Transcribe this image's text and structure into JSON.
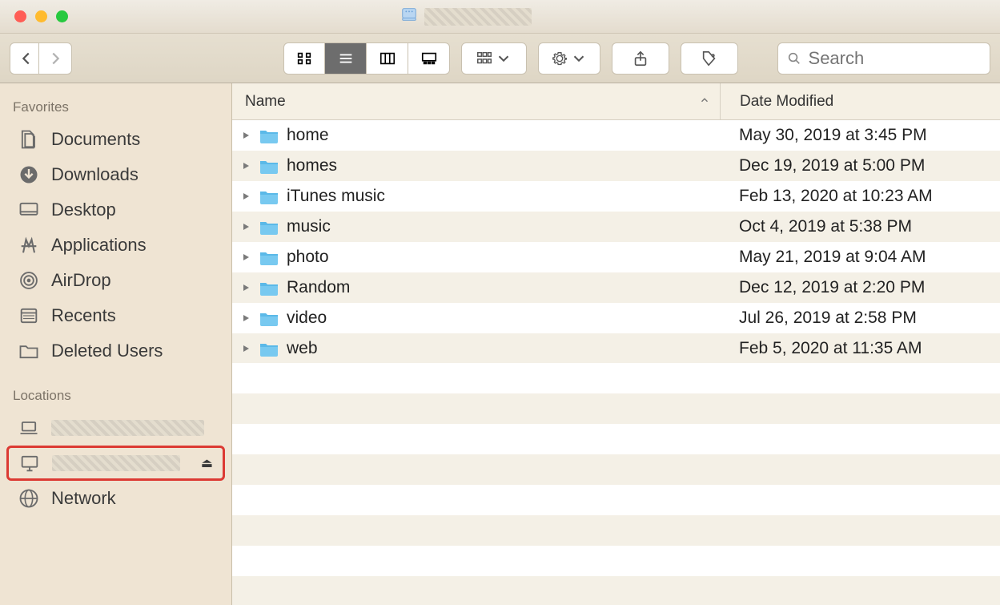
{
  "window": {
    "title_obscured": true
  },
  "sidebar": {
    "favorites_label": "Favorites",
    "locations_label": "Locations",
    "favorites": [
      {
        "label": "Documents",
        "icon": "documents"
      },
      {
        "label": "Downloads",
        "icon": "downloads"
      },
      {
        "label": "Desktop",
        "icon": "desktop"
      },
      {
        "label": "Applications",
        "icon": "applications"
      },
      {
        "label": "AirDrop",
        "icon": "airdrop"
      },
      {
        "label": "Recents",
        "icon": "recents"
      },
      {
        "label": "Deleted Users",
        "icon": "folder"
      }
    ],
    "locations": [
      {
        "label_obscured": true,
        "icon": "laptop",
        "highlighted": false,
        "eject": false
      },
      {
        "label_obscured": true,
        "icon": "monitor",
        "highlighted": true,
        "eject": true
      },
      {
        "label": "Network",
        "icon": "network",
        "highlighted": false,
        "eject": false
      }
    ]
  },
  "columns": {
    "name": "Name",
    "date": "Date Modified"
  },
  "rows": [
    {
      "name": "home",
      "date": "May 30, 2019 at 3:45 PM"
    },
    {
      "name": "homes",
      "date": "Dec 19, 2019 at 5:00 PM"
    },
    {
      "name": "iTunes music",
      "date": "Feb 13, 2020 at 10:23 AM"
    },
    {
      "name": "music",
      "date": "Oct 4, 2019 at 5:38 PM"
    },
    {
      "name": "photo",
      "date": "May 21, 2019 at 9:04 AM"
    },
    {
      "name": "Random",
      "date": "Dec 12, 2019 at 2:20 PM"
    },
    {
      "name": "video",
      "date": "Jul 26, 2019 at 2:58 PM"
    },
    {
      "name": "web",
      "date": "Feb 5, 2020 at 11:35 AM"
    }
  ],
  "search": {
    "placeholder": "Search"
  }
}
